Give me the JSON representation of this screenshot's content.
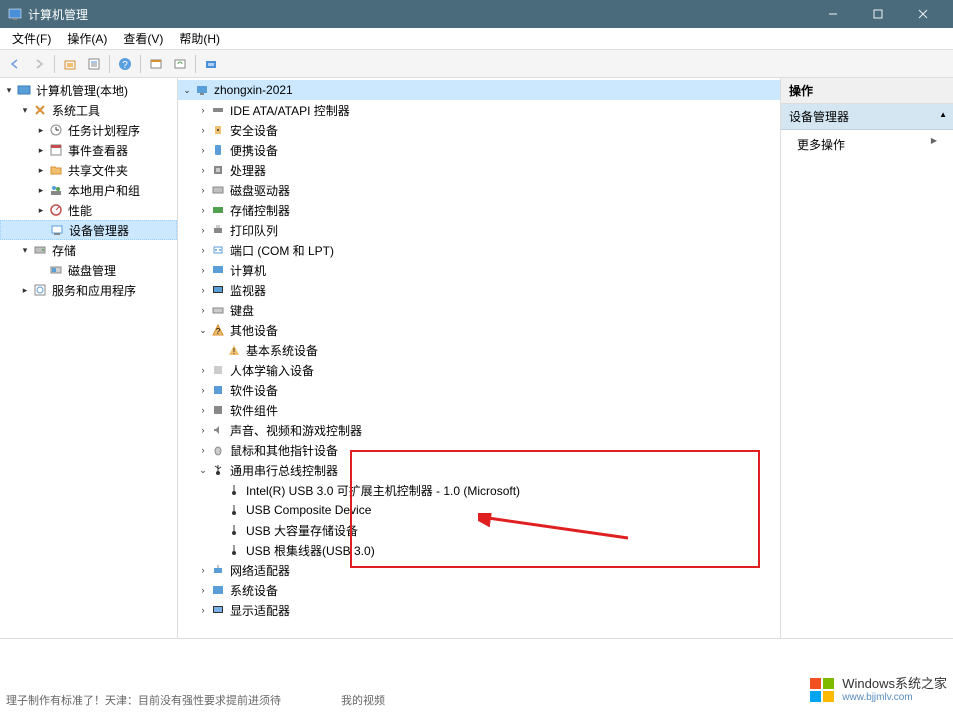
{
  "window": {
    "title": "计算机管理"
  },
  "menu": {
    "file": "文件(F)",
    "action": "操作(A)",
    "view": "查看(V)",
    "help": "帮助(H)"
  },
  "left_tree": {
    "root": "计算机管理(本地)",
    "system_tools": "系统工具",
    "task_scheduler": "任务计划程序",
    "event_viewer": "事件查看器",
    "shared_folders": "共享文件夹",
    "local_users": "本地用户和组",
    "performance": "性能",
    "device_manager": "设备管理器",
    "storage": "存储",
    "disk_mgmt": "磁盘管理",
    "services_apps": "服务和应用程序"
  },
  "mid_tree": {
    "computer": "zhongxin-2021",
    "ide": "IDE ATA/ATAPI 控制器",
    "security": "安全设备",
    "portable": "便携设备",
    "processor": "处理器",
    "disk_drives": "磁盘驱动器",
    "storage_ctrl": "存储控制器",
    "print_q": "打印队列",
    "ports": "端口 (COM 和 LPT)",
    "computers": "计算机",
    "monitors": "监视器",
    "keyboards": "键盘",
    "other": "其他设备",
    "base_sys": "基本系统设备",
    "hid": "人体学输入设备",
    "sw_devices": "软件设备",
    "sw_components": "软件组件",
    "sound": "声音、视频和游戏控制器",
    "mice": "鼠标和其他指针设备",
    "usb_ctrl": "通用串行总线控制器",
    "usb1": "Intel(R) USB 3.0 可扩展主机控制器 - 1.0 (Microsoft)",
    "usb2": "USB Composite Device",
    "usb3": "USB 大容量存储设备",
    "usb4": "USB 根集线器(USB 3.0)",
    "network": "网络适配器",
    "system_dev": "系统设备",
    "display": "显示适配器"
  },
  "right": {
    "header": "操作",
    "section": "设备管理器",
    "more": "更多操作"
  },
  "footer": {
    "text1": "理子制作有标准了！天津：目前没有强性要求提前进须待",
    "text2": "我的视频"
  },
  "watermark": {
    "title": "Windows系统之家",
    "url": "www.bjjmlv.com"
  }
}
